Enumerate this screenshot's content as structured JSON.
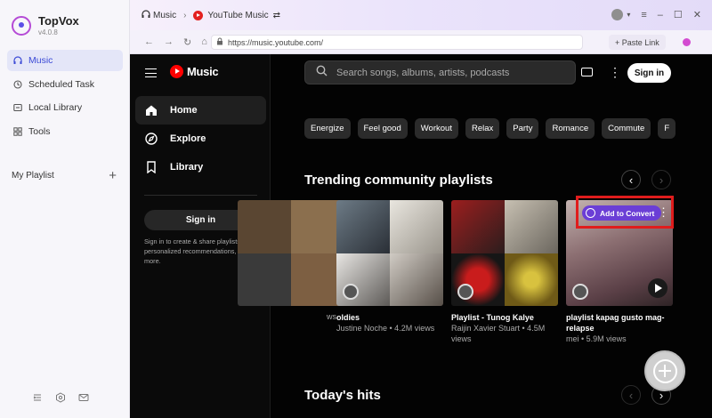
{
  "app": {
    "name": "TopVox",
    "version": "v4.0.8",
    "sidebar": {
      "items": [
        {
          "label": "Music",
          "icon": "headphones-icon",
          "active": true
        },
        {
          "label": "Scheduled Task",
          "icon": "clock-icon"
        },
        {
          "label": "Local Library",
          "icon": "folder-icon"
        },
        {
          "label": "Tools",
          "icon": "grid-icon"
        }
      ],
      "playlist_label": "My Playlist",
      "add_label": "+"
    }
  },
  "topbar": {
    "crumb_music": "Music",
    "crumb_source": "YouTube Music",
    "swap_glyph": "⇄"
  },
  "address": {
    "url": "https://music.youtube.com/",
    "paste_label": "+ Paste Link"
  },
  "ytm": {
    "logo_text": "Music",
    "nav": [
      {
        "label": "Home",
        "icon": "home-icon",
        "active": true
      },
      {
        "label": "Explore",
        "icon": "compass-icon"
      },
      {
        "label": "Library",
        "icon": "bookmark-icon"
      }
    ],
    "sidebar_signin": "Sign in",
    "signin_note": "Sign in to create & share playlists, get personalized recommendations, and more.",
    "search_placeholder": "Search songs, albums, artists, podcasts",
    "signin_button": "Sign in",
    "chips": [
      "Energize",
      "Feel good",
      "Workout",
      "Relax",
      "Party",
      "Romance",
      "Commute",
      "F"
    ],
    "trending_title": "Trending community playlists",
    "cards": [
      {
        "title": "",
        "sub1": "",
        "sub2": "ws"
      },
      {
        "title": "oldies",
        "sub1": "Justine Noche • 4.2M views",
        "sub2": ""
      },
      {
        "title": "Playlist - Tunog Kalye",
        "sub1": "Raijin Xavier Stuart • 4.5M",
        "sub2": "views"
      },
      {
        "title": "playlist kapag gusto mag-",
        "sub1": "relapse",
        "sub2": "mei • 5.9M views"
      }
    ],
    "add_to_convert": "Add to Convert",
    "todays_hits": "Today's hits"
  }
}
